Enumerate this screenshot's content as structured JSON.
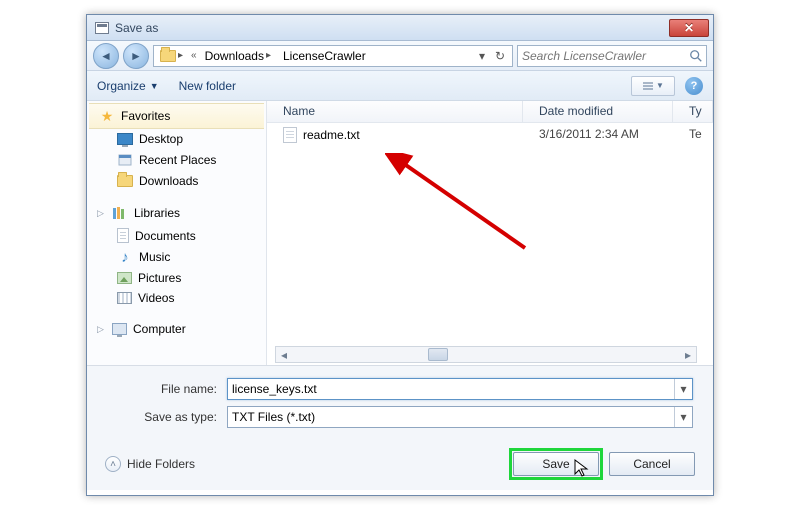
{
  "window": {
    "title": "Save as"
  },
  "nav": {
    "breadcrumb": {
      "seg1": "Downloads",
      "seg2": "LicenseCrawler"
    },
    "search_placeholder": "Search LicenseCrawler"
  },
  "toolbar": {
    "organize": "Organize",
    "newfolder": "New folder"
  },
  "sidebar": {
    "favorites": {
      "label": "Favorites",
      "desktop": "Desktop",
      "recent": "Recent Places",
      "downloads": "Downloads"
    },
    "libraries": {
      "label": "Libraries",
      "documents": "Documents",
      "music": "Music",
      "pictures": "Pictures",
      "videos": "Videos"
    },
    "computer": {
      "label": "Computer"
    }
  },
  "list": {
    "headers": {
      "name": "Name",
      "date": "Date modified",
      "type": "Ty"
    },
    "rows": [
      {
        "name": "readme.txt",
        "date": "3/16/2011 2:34 AM",
        "type": "Te"
      }
    ]
  },
  "form": {
    "filename_label": "File name:",
    "filename_value": "license_keys.txt",
    "savetype_label": "Save as type:",
    "savetype_value": "TXT Files (*.txt)"
  },
  "footer": {
    "hidefolders": "Hide Folders",
    "save": "Save",
    "cancel": "Cancel"
  }
}
